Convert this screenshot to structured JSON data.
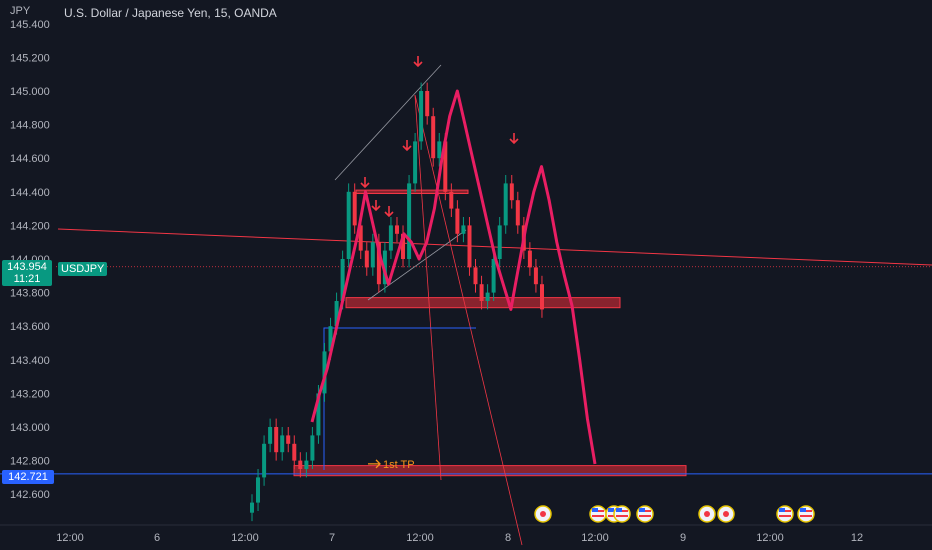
{
  "header": {
    "currency": "JPY",
    "title": "U.S. Dollar / Japanese Yen, 15, OANDA"
  },
  "price_tag": {
    "price": "143.954",
    "countdown": "11:21",
    "symbol": "USDJPY",
    "color": "#089981"
  },
  "level_tag": {
    "price": "142.721",
    "color": "#2962ff"
  },
  "colors": {
    "background": "#131722",
    "pattern": "#e91e63",
    "annotation": "#f23645",
    "zone_fill": "#b22833",
    "up": "#089981",
    "down": "#f23645"
  },
  "chart_data": {
    "type": "candlestick",
    "title": "U.S. Dollar / Japanese Yen, 15, OANDA",
    "y_ticks": [
      "145.400",
      "145.200",
      "145.000",
      "144.800",
      "144.600",
      "144.400",
      "144.200",
      "144.000",
      "143.800",
      "143.600",
      "143.400",
      "143.200",
      "143.000",
      "142.800",
      "142.600"
    ],
    "x_ticks": [
      "12:00",
      "6",
      "12:00",
      "7",
      "12:00",
      "8",
      "12:00",
      "9",
      "12:00",
      "12"
    ],
    "ylim": [
      142.48,
      145.44
    ],
    "series": [
      {
        "name": "USDJPY",
        "values": [
          142.55,
          142.7,
          142.9,
          143.0,
          142.85,
          142.95,
          142.9,
          142.8,
          142.75,
          142.8,
          142.95,
          143.2,
          143.45,
          143.6,
          143.75,
          144.0,
          144.4,
          144.2,
          144.05,
          143.95,
          144.1,
          143.85,
          144.05,
          144.2,
          144.15,
          144.0,
          144.45,
          144.7,
          145.0,
          144.85,
          144.6,
          144.7,
          144.4,
          144.3,
          144.15,
          144.2,
          143.95,
          143.85,
          143.75,
          143.8,
          144.0,
          144.2,
          144.45,
          144.35,
          144.2,
          144.05,
          143.95,
          143.85,
          143.7
        ]
      }
    ],
    "pattern": [
      143.03,
      143.2,
      143.35,
      143.55,
      143.75,
      143.95,
      144.15,
      144.4,
      144.2,
      144.0,
      143.85,
      144.0,
      144.15,
      144.1,
      144.0,
      144.1,
      144.3,
      144.6,
      144.85,
      145.0,
      144.8,
      144.6,
      144.4,
      144.2,
      144.0,
      143.85,
      143.7,
      143.95,
      144.2,
      144.4,
      144.55,
      144.35,
      144.1,
      143.9,
      143.72,
      143.4,
      143.05,
      142.78
    ],
    "levels": {
      "current": 143.954,
      "tp": 142.721
    },
    "zones": [
      {
        "price_low": 143.71,
        "price_high": 143.77
      },
      {
        "price_low": 142.71,
        "price_high": 142.77
      },
      {
        "price_low": 144.39,
        "price_high": 144.41
      }
    ],
    "annotations": [
      {
        "text": "1st TP"
      }
    ]
  }
}
